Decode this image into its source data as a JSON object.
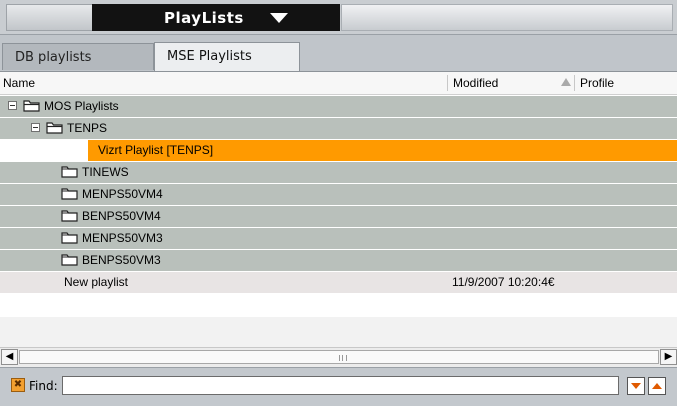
{
  "window": {
    "title": "PlayLists"
  },
  "tabs": [
    {
      "label": "DB playlists",
      "active": false
    },
    {
      "label": "MSE Playlists",
      "active": true
    }
  ],
  "columns": {
    "name": "Name",
    "modified": "Modified",
    "profile": "Profile"
  },
  "tree": {
    "root": "MOS Playlists",
    "tenps": "TENPS",
    "selected_item": "Vizrt Playlist [TENPS]",
    "folders": [
      "TINEWS",
      "MENPS50VM4",
      "BENPS50VM4",
      "MENPS50VM3",
      "BENPS50VM3"
    ],
    "new_playlist": {
      "name": "New playlist",
      "modified": "11/9/2007 10:20:4€"
    }
  },
  "find": {
    "label": "Find:",
    "value": ""
  },
  "colors": {
    "selected": "#ff9a00",
    "row_bg": "#b9c0bb",
    "title_bg": "#121212"
  }
}
